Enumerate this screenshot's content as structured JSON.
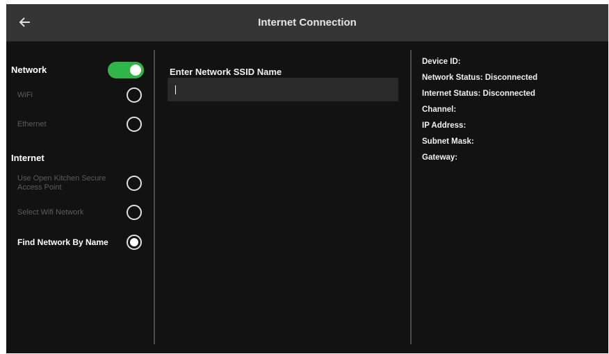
{
  "header": {
    "title": "Internet Connection",
    "back_icon": "back-arrow-icon"
  },
  "network": {
    "label": "Network",
    "toggle_on": true,
    "options": [
      {
        "label": "WiFi",
        "selected": false,
        "enabled": false
      },
      {
        "label": "Ethernet",
        "selected": false,
        "enabled": false
      }
    ]
  },
  "internet": {
    "label": "Internet",
    "options": [
      {
        "label": "Use Open Kitchen Secure Access Point",
        "selected": false,
        "enabled": false
      },
      {
        "label": "Select Wifi Network",
        "selected": false,
        "enabled": false
      },
      {
        "label": "Find Network By Name",
        "selected": true,
        "enabled": true
      }
    ]
  },
  "ssid": {
    "label": "Enter Network SSID Name",
    "value": ""
  },
  "status": {
    "device_id": "Device ID:",
    "network_status": "Network Status: Disconnected",
    "internet_status": "Internet Status: Disconnected",
    "channel": "Channel:",
    "ip_address": "IP Address:",
    "subnet_mask": "Subnet Mask:",
    "gateway": "Gateway:"
  },
  "colors": {
    "toggle_on": "#2fb548",
    "header_bg": "#353535",
    "screen_bg": "#121212"
  }
}
